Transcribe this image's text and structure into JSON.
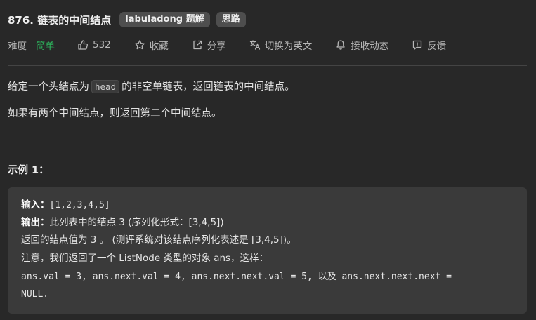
{
  "problem": {
    "title": "876. 链表的中间结点",
    "tags": [
      "labuladong 题解",
      "思路"
    ]
  },
  "meta": {
    "difficulty_label": "难度",
    "difficulty_value": "简单",
    "likes": "532",
    "collect_label": "收藏",
    "share_label": "分享",
    "translate_label": "切换为英文",
    "notify_label": "接收动态",
    "feedback_label": "反馈",
    "icons": [
      "thumbs-up-icon",
      "star-icon",
      "share-icon",
      "translate-icon",
      "bell-icon",
      "feedback-icon"
    ],
    "colors": {
      "difficulty": "#2db55d",
      "background": "#282828",
      "example_box": "#3a3a3a"
    }
  },
  "description": {
    "p1_before": "给定一个头结点为",
    "p1_code": "head",
    "p1_after": "的非空单链表，返回链表的中间结点。",
    "p2": "如果有两个中间结点，则返回第二个中间结点。"
  },
  "example": {
    "title": "示例 1：",
    "input_label": "输入：",
    "input_value": "[1,2,3,4,5]",
    "output_label": "输出：",
    "output_value": "此列表中的结点 3 (序列化形式：[3,4,5])",
    "line3": "返回的结点值为 3 。 (测评系统对该结点序列化表述是 [3,4,5])。",
    "line4": "注意，我们返回了一个 ListNode 类型的对象 ans，这样：",
    "line5": "ans.val = 3, ans.next.val = 4, ans.next.next.val = 5, 以及 ans.next.next.next =",
    "line6": "NULL."
  }
}
